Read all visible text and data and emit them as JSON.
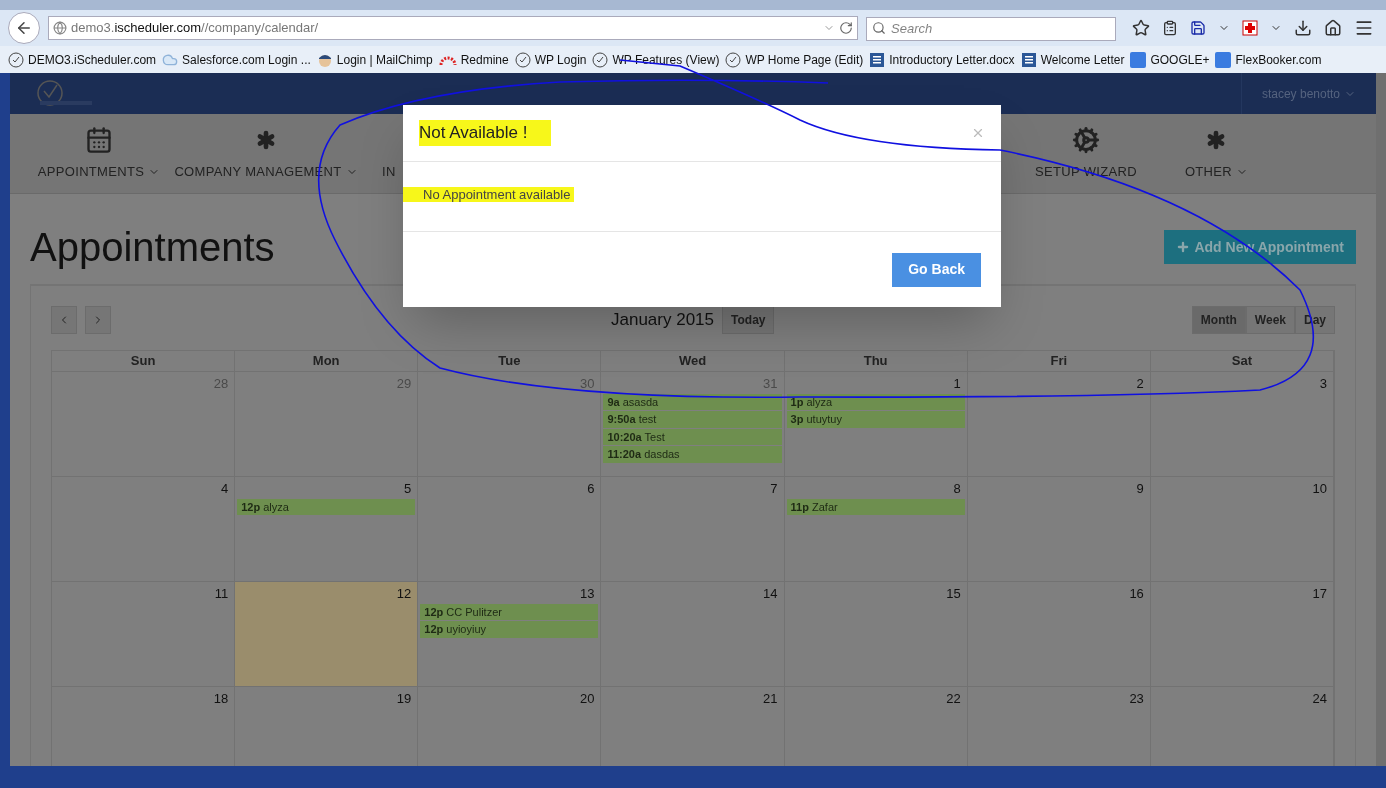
{
  "browser": {
    "url_host_prefix": "demo3.",
    "url_host": "ischeduler.com",
    "url_path": "//company/calendar/",
    "search_placeholder": "Search",
    "bookmarks": [
      {
        "kind": "clock",
        "label": "DEMO3.iScheduler.com"
      },
      {
        "kind": "cloud",
        "label": "Salesforce.com Login ..."
      },
      {
        "kind": "mascot",
        "label": "Login | MailChimp"
      },
      {
        "kind": "gauge",
        "label": "Redmine"
      },
      {
        "kind": "clock",
        "label": "WP Login"
      },
      {
        "kind": "clock",
        "label": "WP Features (View)"
      },
      {
        "kind": "clock",
        "label": "WP Home Page (Edit)"
      },
      {
        "kind": "doc",
        "label": "Introductory Letter.docx"
      },
      {
        "kind": "doc",
        "label": "Welcome Letter"
      },
      {
        "kind": "square",
        "label": "GOOGLE+"
      },
      {
        "kind": "square",
        "label": "FlexBooker.com"
      }
    ]
  },
  "header": {
    "user": "stacey benotto"
  },
  "nav": {
    "left": [
      {
        "label": "APPOINTMENTS",
        "dropdown": true
      },
      {
        "label": "COMPANY MANAGEMENT",
        "dropdown": true
      },
      {
        "label": "IN"
      }
    ],
    "right": [
      {
        "label": "SETUP WIZARD",
        "dropdown": false
      },
      {
        "label": "OTHER",
        "dropdown": true
      }
    ]
  },
  "page": {
    "title": "Appointments",
    "add_button": "Add New Appointment"
  },
  "calendar": {
    "title": "January 2015",
    "today_button": "Today",
    "views": [
      {
        "label": "Month",
        "selected": true
      },
      {
        "label": "Week",
        "selected": false
      },
      {
        "label": "Day",
        "selected": false
      }
    ],
    "weekdays": [
      "Sun",
      "Mon",
      "Tue",
      "Wed",
      "Thu",
      "Fri",
      "Sat"
    ],
    "weeks": [
      [
        {
          "day": "28",
          "other_month": true,
          "today": false
        },
        {
          "day": "29",
          "other_month": true,
          "today": false
        },
        {
          "day": "30",
          "other_month": true,
          "today": false
        },
        {
          "day": "31",
          "other_month": true,
          "today": false,
          "events": [
            {
              "time": "9a",
              "title": "asasda"
            },
            {
              "time": "9:50a",
              "title": "test"
            },
            {
              "time": "10:20a",
              "title": "Test"
            },
            {
              "time": "11:20a",
              "title": "dasdas"
            }
          ]
        },
        {
          "day": "1",
          "other_month": false,
          "today": false,
          "events": [
            {
              "time": "1p",
              "title": "alyza"
            },
            {
              "time": "3p",
              "title": "utuytuy"
            }
          ]
        },
        {
          "day": "2",
          "other_month": false,
          "today": false
        },
        {
          "day": "3",
          "other_month": false,
          "today": false
        }
      ],
      [
        {
          "day": "4",
          "other_month": false,
          "today": false
        },
        {
          "day": "5",
          "other_month": false,
          "today": false,
          "events": [
            {
              "time": "12p",
              "title": "alyza"
            }
          ]
        },
        {
          "day": "6",
          "other_month": false,
          "today": false
        },
        {
          "day": "7",
          "other_month": false,
          "today": false
        },
        {
          "day": "8",
          "other_month": false,
          "today": false,
          "events": [
            {
              "time": "11p",
              "title": "Zafar"
            }
          ]
        },
        {
          "day": "9",
          "other_month": false,
          "today": false
        },
        {
          "day": "10",
          "other_month": false,
          "today": false
        }
      ],
      [
        {
          "day": "11",
          "other_month": false,
          "today": false
        },
        {
          "day": "12",
          "other_month": false,
          "today": true
        },
        {
          "day": "13",
          "other_month": false,
          "today": false,
          "events": [
            {
              "time": "12p",
              "title": "CC Pulitzer"
            },
            {
              "time": "12p",
              "title": "uyioyiuy"
            }
          ]
        },
        {
          "day": "14",
          "other_month": false,
          "today": false
        },
        {
          "day": "15",
          "other_month": false,
          "today": false
        },
        {
          "day": "16",
          "other_month": false,
          "today": false
        },
        {
          "day": "17",
          "other_month": false,
          "today": false
        }
      ],
      [
        {
          "day": "18",
          "other_month": false,
          "today": false
        },
        {
          "day": "19",
          "other_month": false,
          "today": false
        },
        {
          "day": "20",
          "other_month": false,
          "today": false
        },
        {
          "day": "21",
          "other_month": false,
          "today": false
        },
        {
          "day": "22",
          "other_month": false,
          "today": false
        },
        {
          "day": "23",
          "other_month": false,
          "today": false
        },
        {
          "day": "24",
          "other_month": false,
          "today": false
        }
      ]
    ]
  },
  "modal": {
    "title": "Not Available !",
    "message": "No Appointment available",
    "button": "Go Back",
    "highlighted": true
  }
}
